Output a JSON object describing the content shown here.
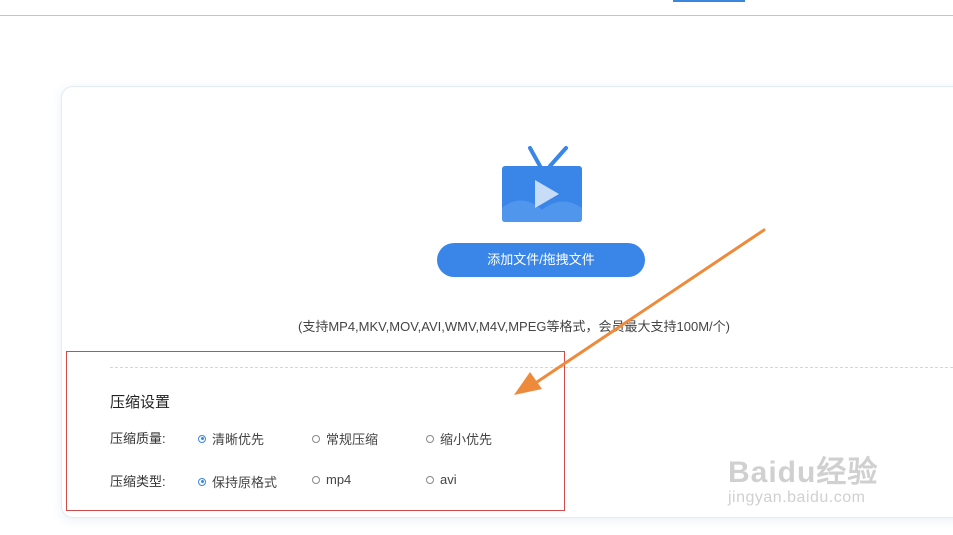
{
  "upload": {
    "button_label": "添加文件/拖拽文件",
    "hint": "(支持MP4,MKV,MOV,AVI,WMV,M4V,MPEG等格式，会员最大支持100M/个)"
  },
  "settings": {
    "title": "压缩设置",
    "quality": {
      "label": "压缩质量:",
      "options": [
        "清晰优先",
        "常规压缩",
        "缩小优先"
      ],
      "selected": "清晰优先"
    },
    "type": {
      "label": "压缩类型:",
      "options": [
        "保持原格式",
        "mp4",
        "avi"
      ],
      "selected": "保持原格式"
    }
  },
  "watermark": {
    "main": "Baidu经验",
    "sub": "jingyan.baidu.com"
  },
  "colors": {
    "accent": "#3a86e8",
    "annotation_box": "#d24b4b",
    "annotation_arrow": "#ee8a3c"
  }
}
